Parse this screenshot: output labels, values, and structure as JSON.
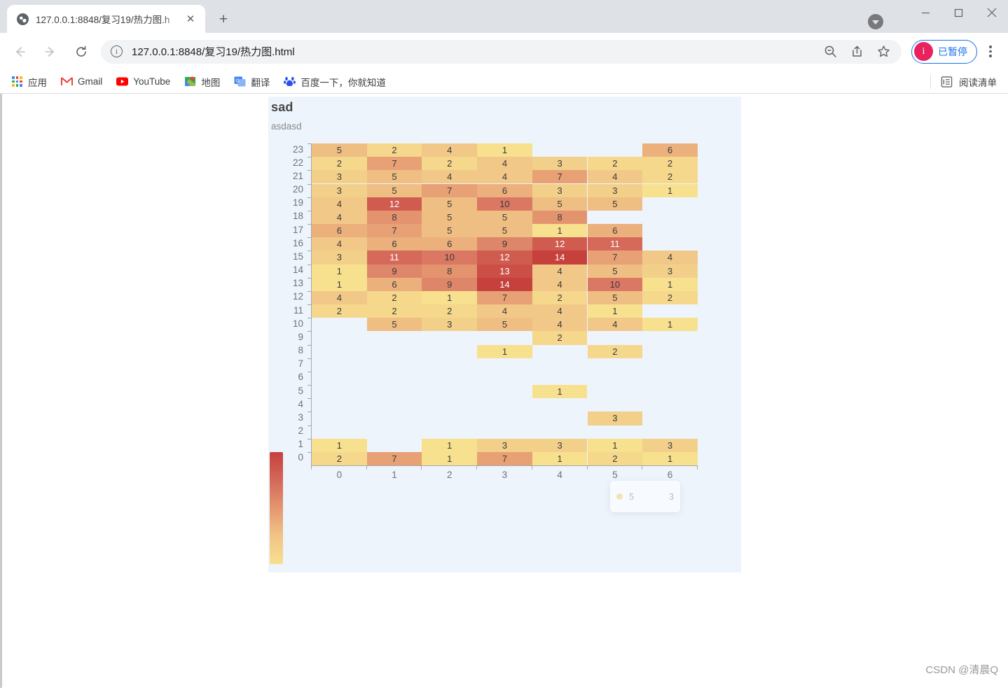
{
  "window": {
    "minimize_icon": "minimize-icon",
    "maximize_icon": "maximize-icon",
    "close_icon": "close-icon",
    "update_icon": "update-arrow-icon"
  },
  "tab": {
    "title": "127.0.0.1:8848/复习19/热力图.h",
    "favicon": "globe-icon",
    "close_label": "✕",
    "new_tab_label": "+"
  },
  "toolbar": {
    "back_label": "←",
    "forward_label": "→",
    "reload_label": "⟳",
    "info_label": "i",
    "url": "127.0.0.1:8848/复习19/热力图.html",
    "zoom_out_icon": "zoom-out-icon",
    "share_icon": "share-icon",
    "bookmark_icon": "star-icon",
    "profile_initial": "i",
    "profile_text": "已暂停",
    "menu_icon": "kebab-menu-icon"
  },
  "bookmarks": {
    "items": [
      {
        "label": "应用",
        "icon": "apps-grid-icon"
      },
      {
        "label": "Gmail",
        "icon": "gmail-icon"
      },
      {
        "label": "YouTube",
        "icon": "youtube-icon"
      },
      {
        "label": "地图",
        "icon": "maps-icon"
      },
      {
        "label": "翻译",
        "icon": "translate-icon"
      },
      {
        "label": "百度一下，你就知道",
        "icon": "baidu-icon"
      }
    ],
    "reading_list": {
      "label": "阅读清单",
      "icon": "reading-list-icon"
    }
  },
  "chart_data": {
    "type": "heatmap",
    "title": "sad",
    "subtitle": "asdasd",
    "xlabel": "",
    "ylabel": "",
    "x_categories": [
      "0",
      "1",
      "2",
      "3",
      "4",
      "5",
      "6"
    ],
    "y_categories": [
      "0",
      "1",
      "2",
      "3",
      "4",
      "5",
      "6",
      "7",
      "8",
      "9",
      "10",
      "11",
      "12",
      "13",
      "14",
      "15",
      "16",
      "17",
      "18",
      "19",
      "20",
      "21",
      "22",
      "23"
    ],
    "value_range": [
      1,
      14
    ],
    "colors": {
      "min": "#f7e08e",
      "mid": "#e59a71",
      "max": "#c6413c",
      "background": "#eef4fc"
    },
    "legend_position": "left-bottom",
    "grid": false,
    "label_show": true,
    "points": [
      {
        "x": 0,
        "y": 23,
        "v": 5
      },
      {
        "x": 1,
        "y": 23,
        "v": 2
      },
      {
        "x": 2,
        "y": 23,
        "v": 4
      },
      {
        "x": 3,
        "y": 23,
        "v": 1
      },
      {
        "x": 6,
        "y": 23,
        "v": 6
      },
      {
        "x": 0,
        "y": 22,
        "v": 2
      },
      {
        "x": 1,
        "y": 22,
        "v": 7
      },
      {
        "x": 2,
        "y": 22,
        "v": 2
      },
      {
        "x": 3,
        "y": 22,
        "v": 4
      },
      {
        "x": 4,
        "y": 22,
        "v": 3
      },
      {
        "x": 5,
        "y": 22,
        "v": 2
      },
      {
        "x": 6,
        "y": 22,
        "v": 2
      },
      {
        "x": 0,
        "y": 21,
        "v": 3
      },
      {
        "x": 1,
        "y": 21,
        "v": 5
      },
      {
        "x": 2,
        "y": 21,
        "v": 4
      },
      {
        "x": 3,
        "y": 21,
        "v": 4
      },
      {
        "x": 4,
        "y": 21,
        "v": 7
      },
      {
        "x": 5,
        "y": 21,
        "v": 4
      },
      {
        "x": 6,
        "y": 21,
        "v": 2
      },
      {
        "x": 0,
        "y": 20,
        "v": 3
      },
      {
        "x": 1,
        "y": 20,
        "v": 5
      },
      {
        "x": 2,
        "y": 20,
        "v": 7
      },
      {
        "x": 3,
        "y": 20,
        "v": 6
      },
      {
        "x": 4,
        "y": 20,
        "v": 3
      },
      {
        "x": 5,
        "y": 20,
        "v": 3
      },
      {
        "x": 6,
        "y": 20,
        "v": 1
      },
      {
        "x": 0,
        "y": 19,
        "v": 4
      },
      {
        "x": 1,
        "y": 19,
        "v": 12
      },
      {
        "x": 2,
        "y": 19,
        "v": 5
      },
      {
        "x": 3,
        "y": 19,
        "v": 10
      },
      {
        "x": 4,
        "y": 19,
        "v": 5
      },
      {
        "x": 5,
        "y": 19,
        "v": 5
      },
      {
        "x": 0,
        "y": 18,
        "v": 4
      },
      {
        "x": 1,
        "y": 18,
        "v": 8
      },
      {
        "x": 2,
        "y": 18,
        "v": 5
      },
      {
        "x": 3,
        "y": 18,
        "v": 5
      },
      {
        "x": 4,
        "y": 18,
        "v": 8
      },
      {
        "x": 0,
        "y": 17,
        "v": 6
      },
      {
        "x": 1,
        "y": 17,
        "v": 7
      },
      {
        "x": 2,
        "y": 17,
        "v": 5
      },
      {
        "x": 3,
        "y": 17,
        "v": 5
      },
      {
        "x": 4,
        "y": 17,
        "v": 1
      },
      {
        "x": 5,
        "y": 17,
        "v": 6
      },
      {
        "x": 0,
        "y": 16,
        "v": 4
      },
      {
        "x": 1,
        "y": 16,
        "v": 6
      },
      {
        "x": 2,
        "y": 16,
        "v": 6
      },
      {
        "x": 3,
        "y": 16,
        "v": 9
      },
      {
        "x": 4,
        "y": 16,
        "v": 12
      },
      {
        "x": 5,
        "y": 16,
        "v": 11
      },
      {
        "x": 0,
        "y": 15,
        "v": 3
      },
      {
        "x": 1,
        "y": 15,
        "v": 11
      },
      {
        "x": 2,
        "y": 15,
        "v": 10
      },
      {
        "x": 3,
        "y": 15,
        "v": 12
      },
      {
        "x": 4,
        "y": 15,
        "v": 14
      },
      {
        "x": 5,
        "y": 15,
        "v": 7
      },
      {
        "x": 6,
        "y": 15,
        "v": 4
      },
      {
        "x": 0,
        "y": 14,
        "v": 1
      },
      {
        "x": 1,
        "y": 14,
        "v": 9
      },
      {
        "x": 2,
        "y": 14,
        "v": 8
      },
      {
        "x": 3,
        "y": 14,
        "v": 13
      },
      {
        "x": 4,
        "y": 14,
        "v": 4
      },
      {
        "x": 5,
        "y": 14,
        "v": 5
      },
      {
        "x": 6,
        "y": 14,
        "v": 3
      },
      {
        "x": 0,
        "y": 13,
        "v": 1
      },
      {
        "x": 1,
        "y": 13,
        "v": 6
      },
      {
        "x": 2,
        "y": 13,
        "v": 9
      },
      {
        "x": 3,
        "y": 13,
        "v": 14
      },
      {
        "x": 4,
        "y": 13,
        "v": 4
      },
      {
        "x": 5,
        "y": 13,
        "v": 10
      },
      {
        "x": 6,
        "y": 13,
        "v": 1
      },
      {
        "x": 0,
        "y": 12,
        "v": 4
      },
      {
        "x": 1,
        "y": 12,
        "v": 2
      },
      {
        "x": 2,
        "y": 12,
        "v": 1
      },
      {
        "x": 3,
        "y": 12,
        "v": 7
      },
      {
        "x": 4,
        "y": 12,
        "v": 2
      },
      {
        "x": 5,
        "y": 12,
        "v": 5
      },
      {
        "x": 6,
        "y": 12,
        "v": 2
      },
      {
        "x": 0,
        "y": 11,
        "v": 2
      },
      {
        "x": 1,
        "y": 11,
        "v": 2
      },
      {
        "x": 2,
        "y": 11,
        "v": 2
      },
      {
        "x": 3,
        "y": 11,
        "v": 4
      },
      {
        "x": 4,
        "y": 11,
        "v": 4
      },
      {
        "x": 5,
        "y": 11,
        "v": 1
      },
      {
        "x": 1,
        "y": 10,
        "v": 5
      },
      {
        "x": 2,
        "y": 10,
        "v": 3
      },
      {
        "x": 3,
        "y": 10,
        "v": 5
      },
      {
        "x": 4,
        "y": 10,
        "v": 4
      },
      {
        "x": 5,
        "y": 10,
        "v": 4
      },
      {
        "x": 6,
        "y": 10,
        "v": 1
      },
      {
        "x": 4,
        "y": 9,
        "v": 2
      },
      {
        "x": 3,
        "y": 8,
        "v": 1
      },
      {
        "x": 5,
        "y": 8,
        "v": 2
      },
      {
        "x": 4,
        "y": 5,
        "v": 1
      },
      {
        "x": 5,
        "y": 3,
        "v": 3
      },
      {
        "x": 0,
        "y": 1,
        "v": 1
      },
      {
        "x": 2,
        "y": 1,
        "v": 1
      },
      {
        "x": 3,
        "y": 1,
        "v": 3
      },
      {
        "x": 4,
        "y": 1,
        "v": 3
      },
      {
        "x": 5,
        "y": 1,
        "v": 1
      },
      {
        "x": 6,
        "y": 1,
        "v": 3
      },
      {
        "x": 0,
        "y": 0,
        "v": 2
      },
      {
        "x": 1,
        "y": 0,
        "v": 7
      },
      {
        "x": 2,
        "y": 0,
        "v": 1
      },
      {
        "x": 3,
        "y": 0,
        "v": 7
      },
      {
        "x": 4,
        "y": 0,
        "v": 1
      },
      {
        "x": 5,
        "y": 0,
        "v": 2
      },
      {
        "x": 6,
        "y": 0,
        "v": 1
      }
    ]
  },
  "tooltip": {
    "marker": "series-dot-icon",
    "key": "5",
    "value": "3"
  },
  "watermark": "CSDN @清晨Q"
}
